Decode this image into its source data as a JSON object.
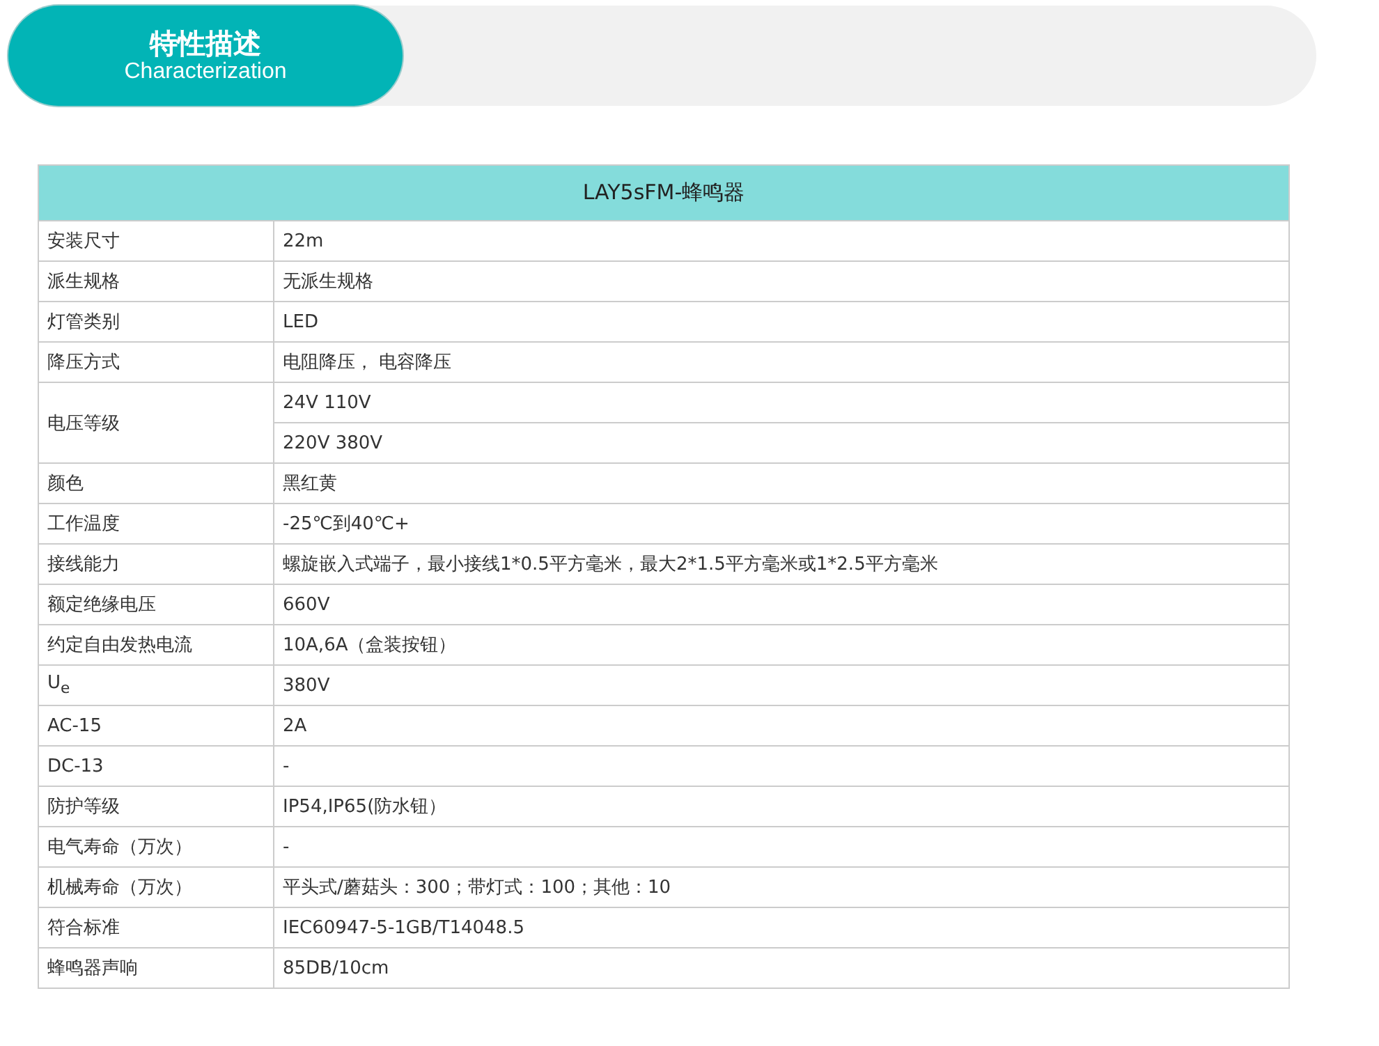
{
  "banner": {
    "title": "特性描述",
    "subtitle": "Characterization"
  },
  "table": {
    "title": "LAY5sFM-蜂鸣器",
    "rows": [
      {
        "label": "安装尺寸",
        "values": [
          "22m"
        ]
      },
      {
        "label": "派生规格",
        "values": [
          "无派生规格"
        ]
      },
      {
        "label": "灯管类别",
        "values": [
          "LED"
        ]
      },
      {
        "label": "降压方式",
        "values": [
          "电阻降压， 电容降压"
        ]
      },
      {
        "label": "电压等级",
        "values": [
          "24V 110V",
          "220V 380V"
        ]
      },
      {
        "label": "颜色",
        "values": [
          "黑红黄"
        ]
      },
      {
        "label": "工作温度",
        "values": [
          "-25℃到40℃+"
        ]
      },
      {
        "label": "接线能力",
        "values": [
          "螺旋嵌入式端子，最小接线1*0.5平方毫米，最大2*1.5平方毫米或1*2.5平方毫米"
        ]
      },
      {
        "label": "额定绝缘电压",
        "values": [
          "660V"
        ]
      },
      {
        "label": "约定自由发热电流",
        "values": [
          "10A,6A（盒装按钮）"
        ]
      },
      {
        "label": "U$_{e}$",
        "values": [
          "380V"
        ]
      },
      {
        "label": "AC-15",
        "values": [
          "2A"
        ]
      },
      {
        "label": "DC-13",
        "values": [
          "-"
        ]
      },
      {
        "label": "防护等级",
        "values": [
          "IP54,IP65(防水钮）"
        ]
      },
      {
        "label": "电气寿命（万次）",
        "values": [
          "-"
        ]
      },
      {
        "label": "机械寿命（万次）",
        "values": [
          "平头式/蘑菇头：300；带灯式：100；其他：10"
        ]
      },
      {
        "label": "符合标准",
        "values": [
          "IEC60947-5-1GB/T14048.5"
        ]
      },
      {
        "label": "蜂鸣器声响",
        "values": [
          "85DB/10cm"
        ]
      }
    ]
  }
}
